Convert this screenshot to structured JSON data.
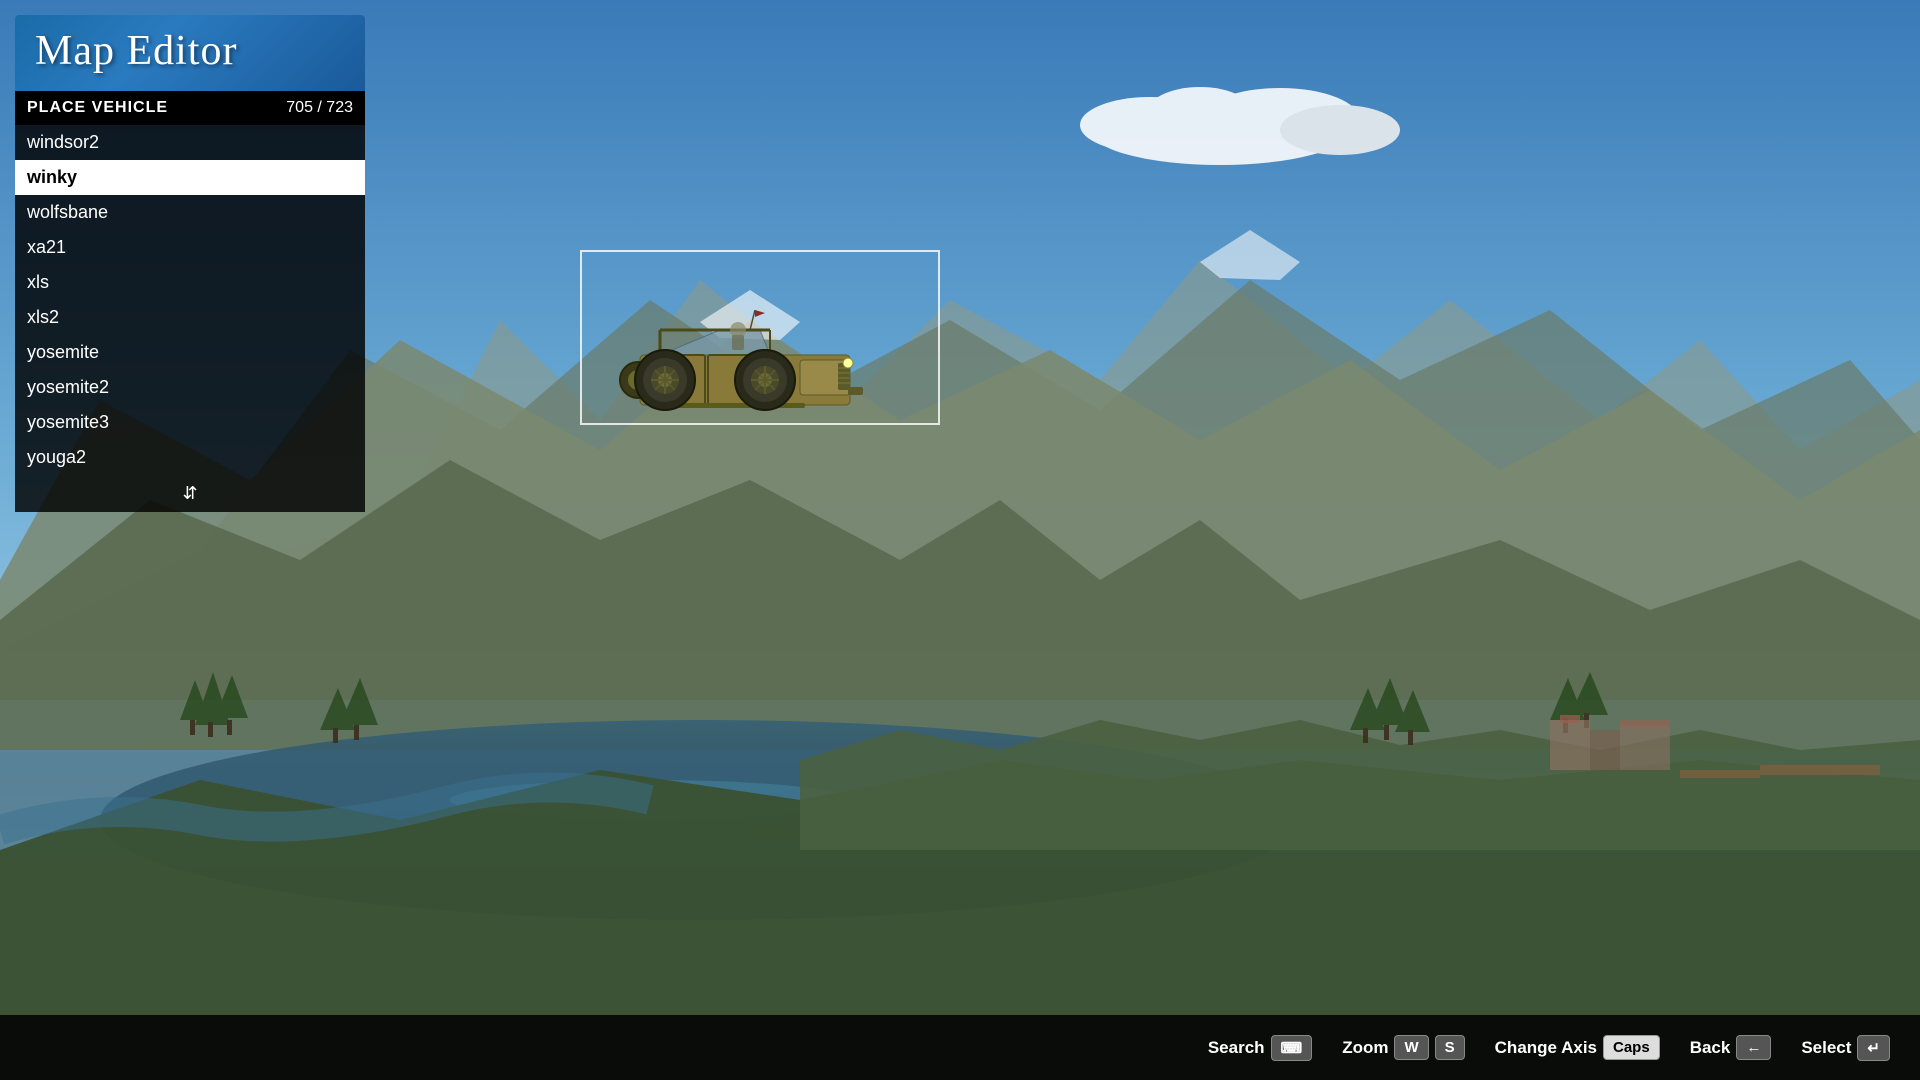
{
  "title": "Map Editor",
  "panel": {
    "header_label": "PLACE VEHICLE",
    "counter": "705 / 723",
    "items": [
      {
        "name": "windsor2",
        "selected": false
      },
      {
        "name": "winky",
        "selected": true
      },
      {
        "name": "wolfsbane",
        "selected": false
      },
      {
        "name": "xa21",
        "selected": false
      },
      {
        "name": "xls",
        "selected": false
      },
      {
        "name": "xls2",
        "selected": false
      },
      {
        "name": "yosemite",
        "selected": false
      },
      {
        "name": "yosemite2",
        "selected": false
      },
      {
        "name": "yosemite3",
        "selected": false
      },
      {
        "name": "youga2",
        "selected": false
      }
    ]
  },
  "controls": [
    {
      "label": "Search",
      "key": "⌨",
      "key_style": "normal"
    },
    {
      "label": "Zoom",
      "key": "W",
      "key_style": "normal"
    },
    {
      "label": "",
      "key": "S",
      "key_style": "normal"
    },
    {
      "label": "Change Axis",
      "key": "Caps",
      "key_style": "light"
    },
    {
      "label": "Back",
      "key": "←",
      "key_style": "normal"
    },
    {
      "label": "Select",
      "key": "↵",
      "key_style": "normal"
    }
  ],
  "colors": {
    "sky_top": "#4a90c4",
    "sky_bottom": "#a8d4e8",
    "mountain": "#4a5a3a",
    "water": "#3a6a8a",
    "panel_bg": "rgba(0,0,0,0.82)",
    "title_bg": "#1a6ba8",
    "selected_bg": "#ffffff",
    "control_bar_bg": "rgba(0,0,0,0.85)"
  }
}
